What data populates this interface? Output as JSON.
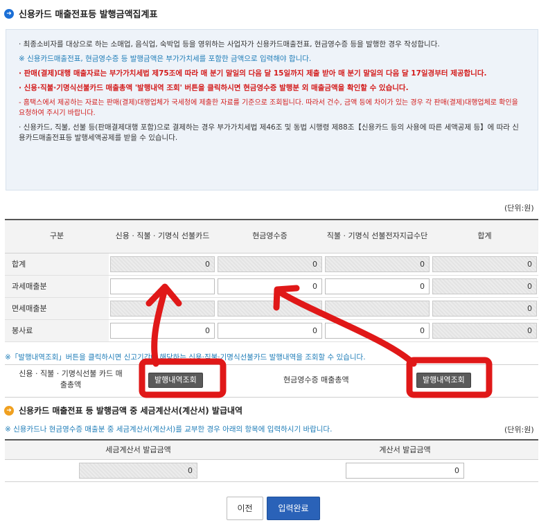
{
  "header": {
    "title": "신용카드 매출전표등 발행금액집계표"
  },
  "info": {
    "line1": "· 최종소비자를 대상으로 하는 소매업, 음식업, 숙박업 등을 영위하는 사업자가 신용카드매출전표, 현금영수증 등을 발행한 경우 작성합니다.",
    "line2": "※ 신용카드매출전표, 현금영수증 등 발행금액은 부가가치세를 포함한 금액으로 입력해야 합니다.",
    "line3": "· 판매(결제)대행 매출자료는 부가가치세법 제75조에 따라 매 분기 말일의 다음 달 15일까지 제출 받아 매 분기 말일의 다음 달 17일경부터 제공합니다.",
    "line4": "· 신용·직불·기명식선불카드 매출총액 '발행내역 조회' 버튼을 클릭하시면 현금영수증 발행분 외 매출금액을 확인할 수 있습니다.",
    "line5": "- 홈택스에서 제공하는 자료는 판매(결제)대행업체가 국세청에 제출한 자료를 기준으로 조회됩니다. 따라서 건수, 금액 등에 차이가 있는 경우 각 판매(결제)대행업체로 확인을 요청하여 주시기 바랍니다.",
    "line6": "· 신용카드, 직불, 선불 등(판매결제대행 포함)으로 결제하는 경우 부가가치세법 제46조 및 동법 시행령 제88조【신용카드 등의 사용에 따른 세액공제 등】에 따라 신용카드매출전표등 발행세액공제를 받을 수 있습니다."
  },
  "unit_label": "(단위:원)",
  "table": {
    "headers": [
      "구분",
      "신용 · 직불 · 기명식 선불카드",
      "현금영수증",
      "직불 · 기명식 선불전자지급수단",
      "합계"
    ],
    "rows": [
      {
        "label": "합계",
        "values": [
          "0",
          "0",
          "0",
          "0"
        ]
      },
      {
        "label": "과세매출분",
        "values": [
          "",
          "0",
          "0",
          "0"
        ]
      },
      {
        "label": "면세매출분",
        "values": [
          "",
          "",
          "",
          "0"
        ]
      },
      {
        "label": "봉사료",
        "values": [
          "0",
          "0",
          "0",
          "0"
        ]
      }
    ]
  },
  "note": "※「발행내역조회」버튼을 클릭하시면 신고기간에 해당하는 신용·직불·기명식선불카드 발행내역을 조회할 수 있습니다.",
  "summary": {
    "card_label": "신용 · 직불 · 기명식선불 카드 매출총액",
    "card_button": "발행내역조회",
    "cash_label": "현금영수증 매출총액",
    "cash_button": "발행내역조회"
  },
  "section2": {
    "title": "신용카드 매출전표 등 발행금액 중 세금계산서(계산서) 발급내역",
    "note": "※ 신용카드나 현금영수증 매출분 중 세금계산서(계산서)를 교부한 경우 아래의 항목에 입력하시기 바랍니다.",
    "unit_label": "(단위:원)",
    "headers": [
      "세금계산서 발급금액",
      "계산서 발급금액"
    ],
    "values": [
      "0",
      "0"
    ]
  },
  "buttons": {
    "prev": "이전",
    "submit": "입력완료"
  },
  "colors": {
    "accent_blue": "#2a62b8",
    "annotation_red": "#e01818",
    "note_blue": "#1f7db8"
  }
}
